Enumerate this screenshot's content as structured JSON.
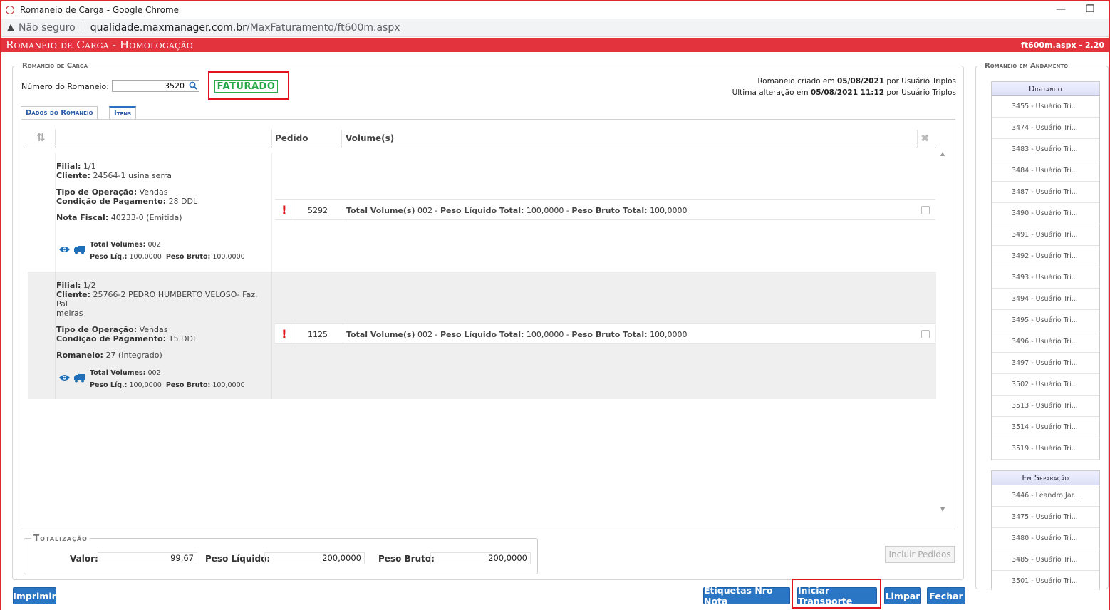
{
  "browser": {
    "window_title": "Romaneio de Carga - Google Chrome",
    "not_secure": "Não seguro",
    "url_host": "qualidade.maxmanager.com.br",
    "url_path": "/MaxFaturamento/ft600m.aspx",
    "minimize": "—",
    "restore": "❐"
  },
  "app": {
    "title": "Romaneio de Carga  - Homologação",
    "version": "ft600m.aspx - 2.20",
    "accent": "#e3343d"
  },
  "romaneio": {
    "legend": "Romaneio de Carga",
    "numero_label": "Número do Romaneio:",
    "numero_value": "3520",
    "status": "FATURADO",
    "criado_prefix": "Romaneio criado em ",
    "criado_data": "05/08/2021",
    "criado_suffix": " por Usuário Triplos",
    "alterado_prefix": "Última alteração em ",
    "alterado_data": "05/08/2021 11:12",
    "alterado_suffix": " por Usuário Triplos"
  },
  "tabs": [
    {
      "label": "Dados do Romaneio"
    },
    {
      "label": "Itens"
    }
  ],
  "table": {
    "col_pedido": "Pedido",
    "col_volumes": "Volume(s)",
    "sort_icon": "⇅",
    "clear_icon": "✖"
  },
  "groups": [
    {
      "filial_label": "Filial:",
      "filial": "1/1",
      "cliente_label": "Cliente:",
      "cliente": "24564-1 usina serra",
      "tipo_label": "Tipo de Operação:",
      "tipo": "Vendas",
      "cond_label": "Condição de Pagamento:",
      "cond": "28 DDL",
      "extra_label": "Nota Fiscal:",
      "extra": "40233-0 (Emitida)",
      "tv_label": "Total Volumes:",
      "tv": "002",
      "pl_label": "Peso Líq.:",
      "pl": "100,0000",
      "pb_label": "Peso Bruto:",
      "pb": "100,0000",
      "pedido": "5292",
      "vol_label": "Total Volume(s)",
      "vol": "002",
      "sep1": " - ",
      "plt_label": "Peso Líquido Total:",
      "plt": "100,0000",
      "sep2": " - ",
      "pbt_label": "Peso Bruto Total:",
      "pbt": "100,0000"
    },
    {
      "filial_label": "Filial:",
      "filial": "1/2",
      "cliente_label": "Cliente:",
      "cliente": "25766-2 PEDRO HUMBERTO VELOSO- Faz. Pal",
      "cliente2": "meiras",
      "tipo_label": "Tipo de Operação:",
      "tipo": "Vendas",
      "cond_label": "Condição de Pagamento:",
      "cond": "15 DDL",
      "extra_label": "Romaneio:",
      "extra": "27 (Integrado)",
      "tv_label": "Total Volumes:",
      "tv": "002",
      "pl_label": "Peso Líq.:",
      "pl": "100,0000",
      "pb_label": "Peso Bruto:",
      "pb": "100,0000",
      "pedido": "1125",
      "vol_label": "Total Volume(s)",
      "vol": "002",
      "sep1": " - ",
      "plt_label": "Peso Líquido Total:",
      "plt": "100,0000",
      "sep2": " - ",
      "pbt_label": "Peso Bruto Total:",
      "pbt": "100,0000"
    }
  ],
  "totalizacao": {
    "legend": "Totalização",
    "valor_label": "Valor:",
    "valor": "99,67",
    "peso_liq_label": "Peso Líquido:",
    "peso_liq": "200,0000",
    "peso_bruto_label": "Peso Bruto:",
    "peso_bruto": "200,0000"
  },
  "buttons": {
    "incluir": "Incluir Pedidos",
    "imprimir": "Imprimir",
    "etiquetas": "Etiquetas Nro Nota",
    "iniciar": "Iniciar Transporte",
    "limpar": "Limpar",
    "fechar": "Fechar"
  },
  "andamento": {
    "legend": "Romaneio em Andamento",
    "digitando_title": "Digitando",
    "digitando": [
      "3455 - Usuário Tri...",
      "3474 - Usuário Tri...",
      "3483 - Usuário Tri...",
      "3484 - Usuário Tri...",
      "3487 - Usuário Tri...",
      "3490 - Usuário Tri...",
      "3491 - Usuário Tri...",
      "3492 - Usuário Tri...",
      "3493 - Usuário Tri...",
      "3494 - Usuário Tri...",
      "3495 - Usuário Tri...",
      "3496 - Usuário Tri...",
      "3497 - Usuário Tri...",
      "3502 - Usuário Tri...",
      "3513 - Usuário Tri...",
      "3514 - Usuário Tri...",
      "3519 - Usuário Tri..."
    ],
    "separacao_title": "Em Separação",
    "separacao": [
      "3446 - Leandro Jar...",
      "3475 - Usuário Tri...",
      "3480 - Usuário Tri...",
      "3485 - Usuário Tri...",
      "3501 - Usuário Tri..."
    ]
  }
}
